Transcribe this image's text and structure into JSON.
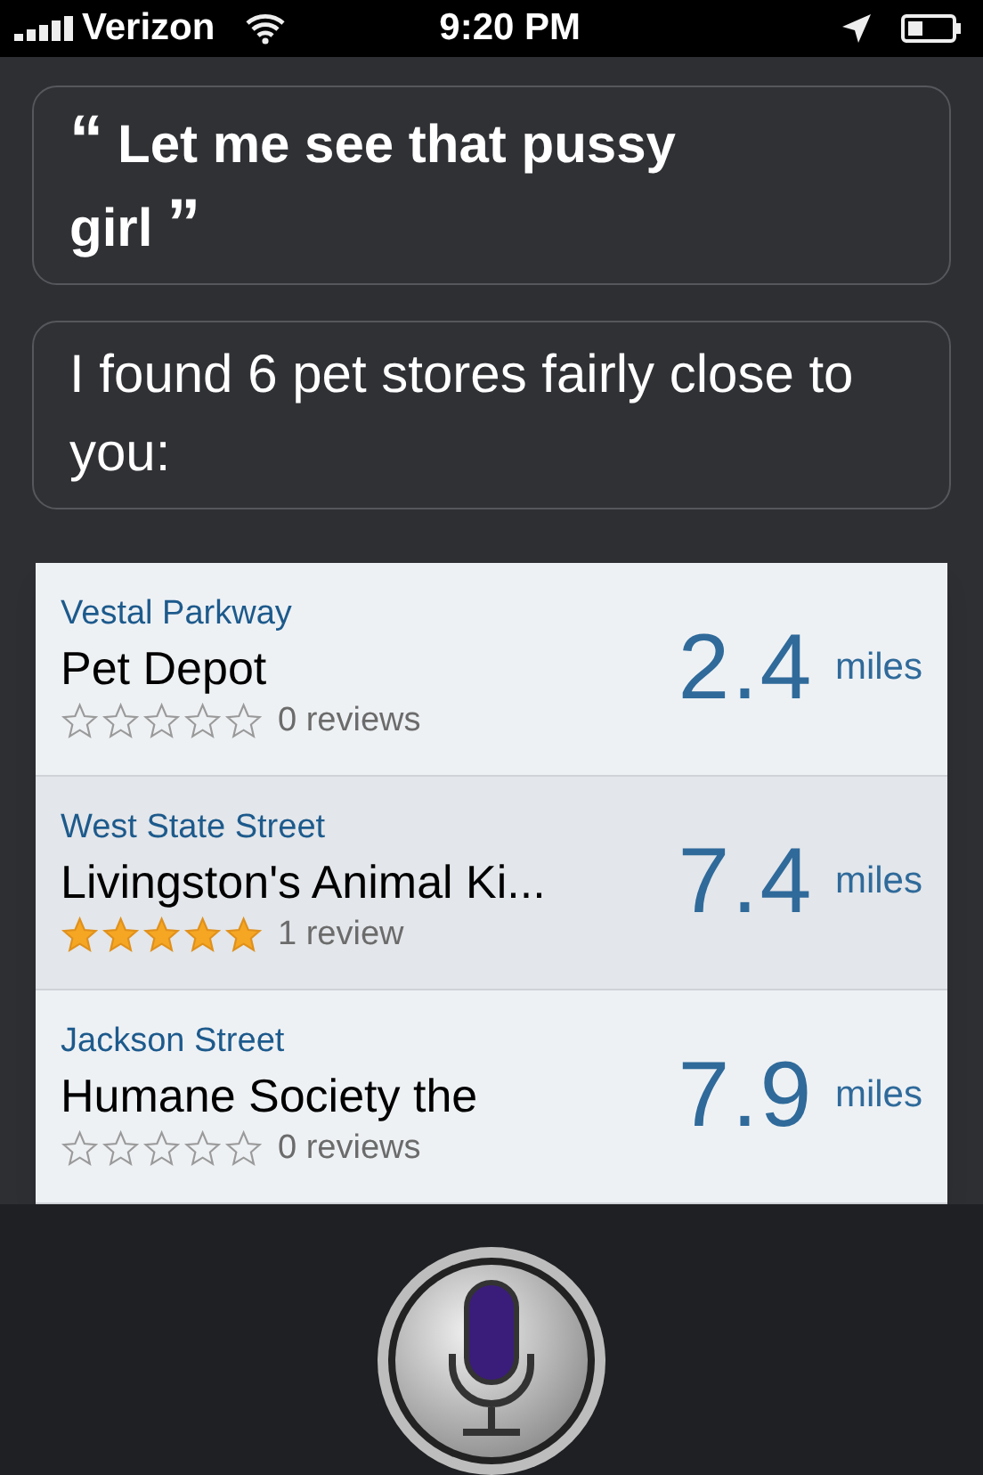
{
  "status_bar": {
    "carrier": "Verizon",
    "time": "9:20 PM"
  },
  "user_quote": {
    "open_mark": "“",
    "text": "Let me see that pussy girl",
    "close_mark": "”"
  },
  "siri_reply": "I found 6 pet stores fairly close to you:",
  "results": [
    {
      "street": "Vestal Parkway",
      "name": "Pet Depot",
      "stars": 0,
      "reviews": "0 reviews",
      "distance": "2.4",
      "unit": "miles"
    },
    {
      "street": "West State Street",
      "name": "Livingston's Animal Ki...",
      "stars": 5,
      "reviews": "1 review",
      "distance": "7.4",
      "unit": "miles"
    },
    {
      "street": "Jackson Street",
      "name": "Humane Society the",
      "stars": 0,
      "reviews": "0 reviews",
      "distance": "7.9",
      "unit": "miles"
    }
  ]
}
